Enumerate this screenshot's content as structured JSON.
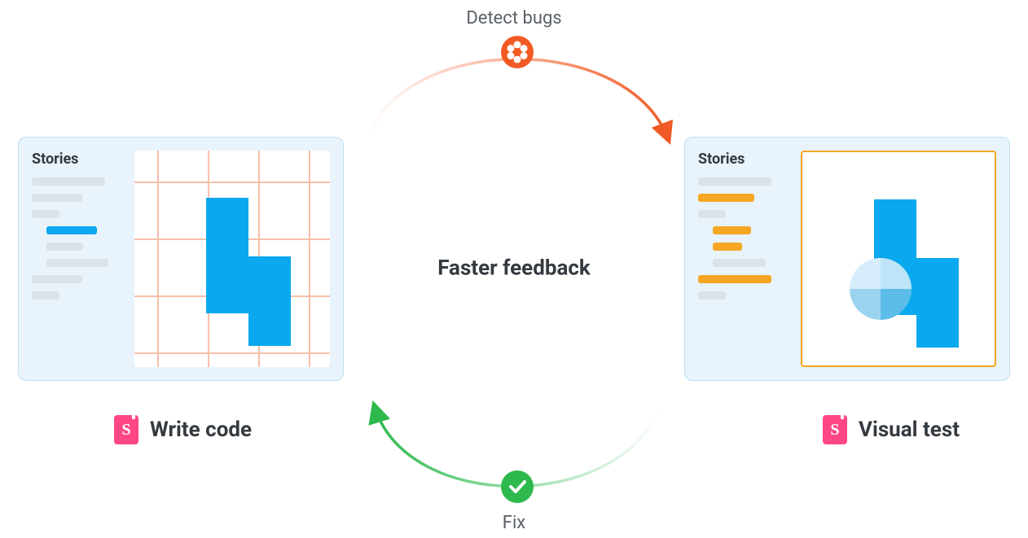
{
  "labels": {
    "top": "Detect bugs",
    "center": "Faster feedback",
    "bottom": "Fix"
  },
  "panels": {
    "left": {
      "sidebar_title": "Stories",
      "caption": "Write code",
      "badge_letter": "S"
    },
    "right": {
      "sidebar_title": "Stories",
      "caption": "Visual test",
      "badge_letter": "S"
    }
  },
  "colors": {
    "accent_blue": "#0aa8ef",
    "accent_orange": "#f5a623",
    "accent_pink": "#ff4785",
    "arc_orange": "#f15a24",
    "arc_green": "#2db94d",
    "panel_bg": "#e8f3fb",
    "grid_line": "#f7bfa7"
  },
  "icons": {
    "top_badge": "chromatic-icon",
    "bottom_badge": "check-icon",
    "caption_badge": "storybook-icon"
  }
}
